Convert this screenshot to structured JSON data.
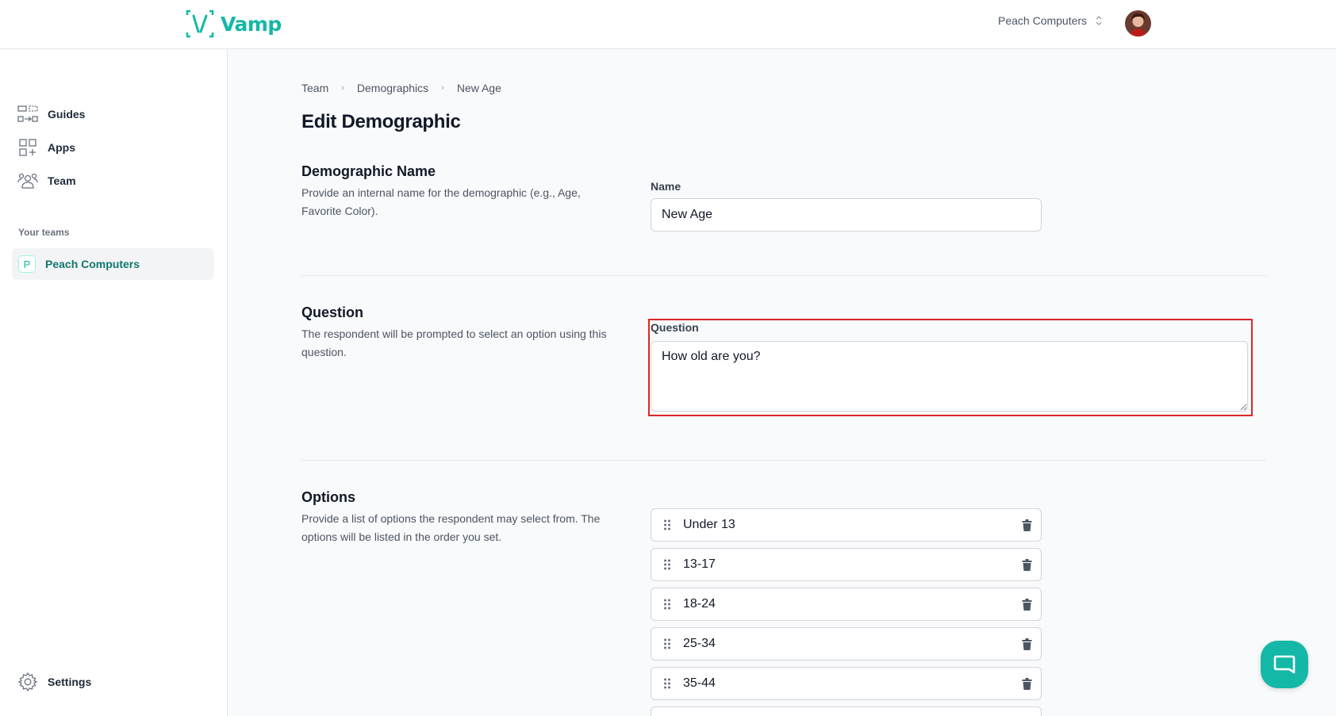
{
  "header": {
    "brand": "Vamp",
    "team_switch": "Peach Computers"
  },
  "sidebar": {
    "items": [
      {
        "label": "Guides",
        "icon": "guides-icon"
      },
      {
        "label": "Apps",
        "icon": "apps-icon"
      },
      {
        "label": "Team",
        "icon": "team-icon"
      }
    ],
    "teams_label": "Your teams",
    "active_team": {
      "initial": "P",
      "label": "Peach Computers"
    },
    "settings_label": "Settings"
  },
  "breadcrumb": [
    "Team",
    "Demographics",
    "New Age"
  ],
  "page_title": "Edit Demographic",
  "sections": {
    "name": {
      "title": "Demographic Name",
      "description": "Provide an internal name for the demographic (e.g., Age, Favorite Color).",
      "field_label": "Name",
      "value": "New Age"
    },
    "question": {
      "title": "Question",
      "description": "The respondent will be prompted to select an option using this question.",
      "field_label": "Question",
      "value": "How old are you?"
    },
    "options": {
      "title": "Options",
      "description": "Provide a list of options the respondent may select from. The options will be listed in the order you set.",
      "items": [
        "Under 13",
        "13-17",
        "18-24",
        "25-34",
        "35-44"
      ]
    }
  },
  "colors": {
    "brand": "#14b8a6",
    "highlight": "#dc2626"
  }
}
